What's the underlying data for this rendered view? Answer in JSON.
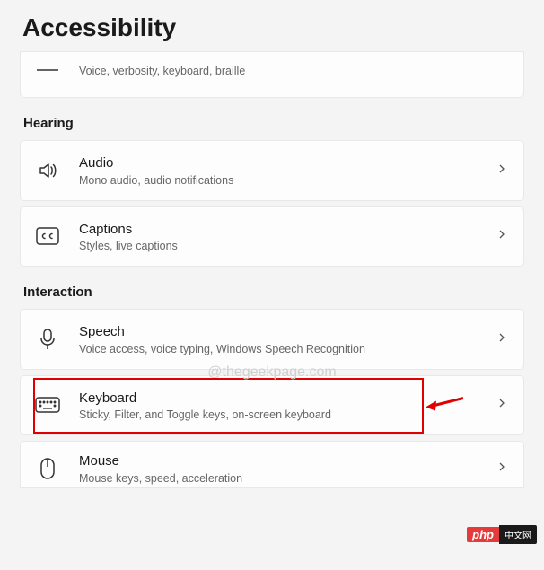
{
  "pageTitle": "Accessibility",
  "partialTop": {
    "desc": "Voice, verbosity, keyboard, braille"
  },
  "sections": {
    "hearing": {
      "heading": "Hearing",
      "items": [
        {
          "title": "Audio",
          "desc": "Mono audio, audio notifications"
        },
        {
          "title": "Captions",
          "desc": "Styles, live captions"
        }
      ]
    },
    "interaction": {
      "heading": "Interaction",
      "items": [
        {
          "title": "Speech",
          "desc": "Voice access, voice typing, Windows Speech Recognition"
        },
        {
          "title": "Keyboard",
          "desc": "Sticky, Filter, and Toggle keys, on-screen keyboard"
        },
        {
          "title": "Mouse",
          "desc": "Mouse keys, speed, acceleration"
        }
      ]
    }
  },
  "watermark": "@thegeekpage.com",
  "badge": {
    "left": "php",
    "right": "中文网"
  }
}
